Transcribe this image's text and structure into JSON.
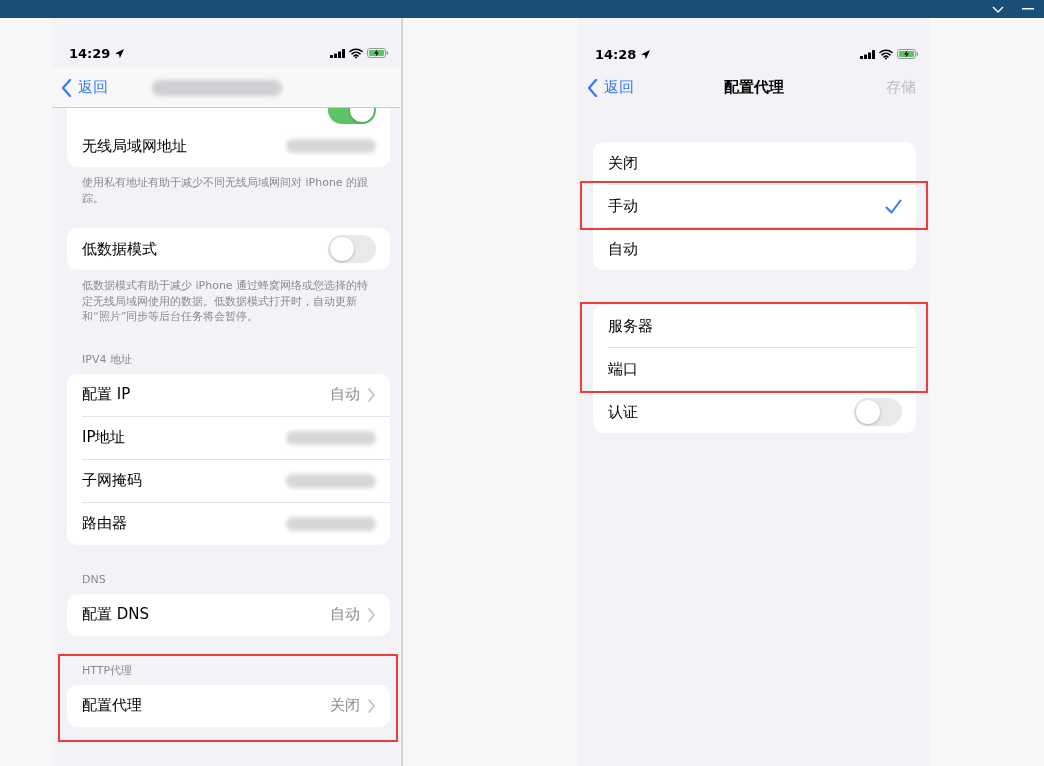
{
  "left_screen": {
    "status_bar": {
      "time": "14:29"
    },
    "nav_bar": {
      "back": "返回",
      "title_redacted": true
    },
    "sections": [
      {
        "rows": [
          {
            "kind": "clipped_toggle",
            "on": true
          },
          {
            "kind": "redacted",
            "label": "无线局域网地址"
          }
        ],
        "footer": "使用私有地址有助于减少不同无线局域网间对 iPhone 的跟踪。"
      },
      {
        "rows": [
          {
            "kind": "toggle",
            "label": "低数据模式",
            "on": false
          }
        ],
        "footer": "低数据模式有助于减少 iPhone 通过蜂窝网络或您选择的特定无线局域网使用的数据。低数据模式打开时，自动更新和“照片”同步等后台任务将会暂停。"
      },
      {
        "header": "IPV4 地址",
        "rows": [
          {
            "kind": "link",
            "label": "配置 IP",
            "value": "自动"
          },
          {
            "kind": "redacted",
            "label": "IP地址"
          },
          {
            "kind": "redacted",
            "label": "子网掩码"
          },
          {
            "kind": "redacted",
            "label": "路由器"
          }
        ]
      },
      {
        "header": "DNS",
        "rows": [
          {
            "kind": "link",
            "label": "配置 DNS",
            "value": "自动"
          }
        ]
      },
      {
        "highlighted": true,
        "header": "HTTP代理",
        "rows": [
          {
            "kind": "link",
            "label": "配置代理",
            "value": "关闭"
          }
        ]
      }
    ]
  },
  "right_screen": {
    "status_bar": {
      "time": "14:28"
    },
    "nav_bar": {
      "back": "返回",
      "title": "配置代理",
      "action": "存储",
      "action_disabled": true
    },
    "sections": [
      {
        "rows": [
          {
            "kind": "option",
            "label": "关闭",
            "selected": false,
            "highlighted": false
          },
          {
            "kind": "option",
            "label": "手动",
            "selected": true,
            "highlighted": true
          },
          {
            "kind": "option",
            "label": "自动",
            "selected": false,
            "highlighted": false
          }
        ]
      },
      {
        "rows": [
          {
            "kind": "field",
            "label": "服务器",
            "highlighted": true
          },
          {
            "kind": "field",
            "label": "端口",
            "highlighted": true
          },
          {
            "kind": "toggle",
            "label": "认证",
            "on": false,
            "highlighted": false
          }
        ]
      }
    ]
  }
}
